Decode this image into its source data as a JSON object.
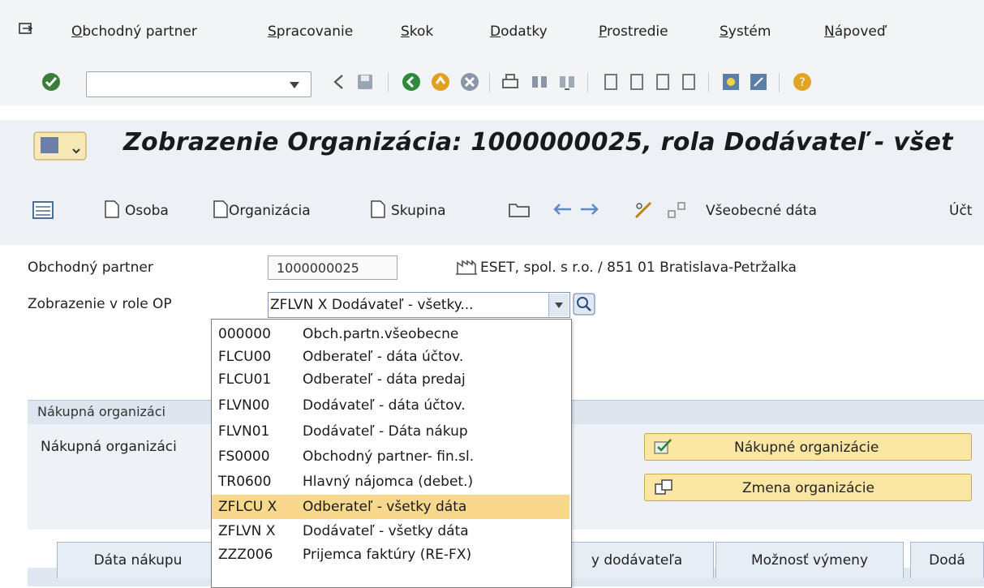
{
  "menubar": {
    "items": [
      "Obchodný partner",
      "Spracovanie",
      "Skok",
      "Dodatky",
      "Prostredie",
      "Systém",
      "Nápoveď"
    ]
  },
  "title": "Zobrazenie Organizácia: 1000000025, rola Dodávateľ - všet",
  "app_toolbar": {
    "osoba": "Osoba",
    "organizacia": "Organizácia",
    "skupina": "Skupina",
    "vseobecne": "Všeobecné dáta",
    "uct": "Účt"
  },
  "form": {
    "bp_label": "Obchodný partner",
    "bp_value": "1000000025",
    "bp_desc": "ESET, spol. s r.o. / 851 01 Bratislava-Petržalka",
    "role_label": "Zobrazenie v role OP",
    "role_value": "ZFLVN X Dodávateľ - všetky..."
  },
  "group": {
    "header": "Nákupná organizáci",
    "label": "Nákupná organizáci",
    "btn_purch_orgs": "Nákupné organizácie",
    "btn_change_org": "Zmena organizácie"
  },
  "tabs": [
    "Dáta nákupu",
    "y dodávateľa",
    "Možnosť výmeny",
    "Dodá"
  ],
  "dropdown": {
    "items": [
      {
        "code": "000000",
        "desc": "Obch.partn.všeobecne"
      },
      {
        "code": "FLCU00",
        "desc": "Odberateľ - dáta účtov."
      },
      {
        "code": "FLCU01",
        "desc": "Odberateľ - dáta predaj"
      },
      {
        "code": "FLVN00",
        "desc": "Dodávateľ - dáta účtov."
      },
      {
        "code": "FLVN01",
        "desc": "Dodávateľ - Dáta nákup"
      },
      {
        "code": "FS0000",
        "desc": "Obchodný partner- fin.sl."
      },
      {
        "code": "TR0600",
        "desc": "Hlavný nájomca (debet.)"
      },
      {
        "code": "ZFLCU X",
        "desc": "Odberateľ - všetky dáta"
      },
      {
        "code": "ZFLVN X",
        "desc": "Dodávateľ - všetky dáta"
      },
      {
        "code": "ZZZ006",
        "desc": "Prijemca faktúry (RE-FX)"
      }
    ]
  },
  "colors": {
    "highlight": "#f7d88c",
    "button_yellow": "#fbe6a3",
    "header_bg": "#edf1f6"
  }
}
